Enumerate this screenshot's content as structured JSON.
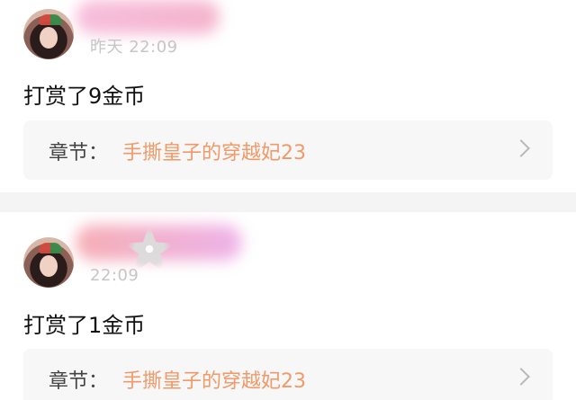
{
  "items": [
    {
      "time": "昨天 22:09",
      "reward_text": "打赏了9金币",
      "chapter_label": "章节：",
      "chapter_title": "手撕皇子的穿越妃23"
    },
    {
      "time": "22:09",
      "reward_text": "打赏了1金币",
      "chapter_label": "章节：",
      "chapter_title": "手撕皇子的穿越妃23"
    }
  ]
}
